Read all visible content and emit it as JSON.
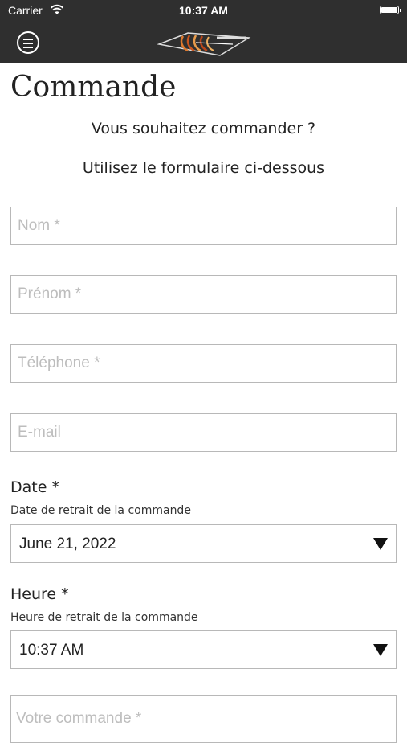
{
  "status_bar": {
    "carrier": "Carrier",
    "time": "10:37 AM"
  },
  "nav": {
    "menu_icon": "menu-circle-icon",
    "logo": "brand-logo"
  },
  "page": {
    "title": "Commande",
    "intro_line_1": "Vous souhaitez commander ?",
    "intro_line_2": "Utilisez le formulaire ci-dessous"
  },
  "form": {
    "nom_placeholder": "Nom *",
    "prenom_placeholder": "Prénom *",
    "telephone_placeholder": "Téléphone *",
    "email_placeholder": "E-mail",
    "date": {
      "label": "Date *",
      "help": "Date de retrait de la commande",
      "value": "June 21, 2022"
    },
    "heure": {
      "label": "Heure *",
      "help": "Heure de retrait de la commande",
      "value": "10:37 AM"
    },
    "commande_placeholder": "Votre commande *"
  },
  "colors": {
    "bar_background": "#2f2f2f",
    "field_border": "#b8b8b8",
    "placeholder": "#bdbdbd"
  }
}
